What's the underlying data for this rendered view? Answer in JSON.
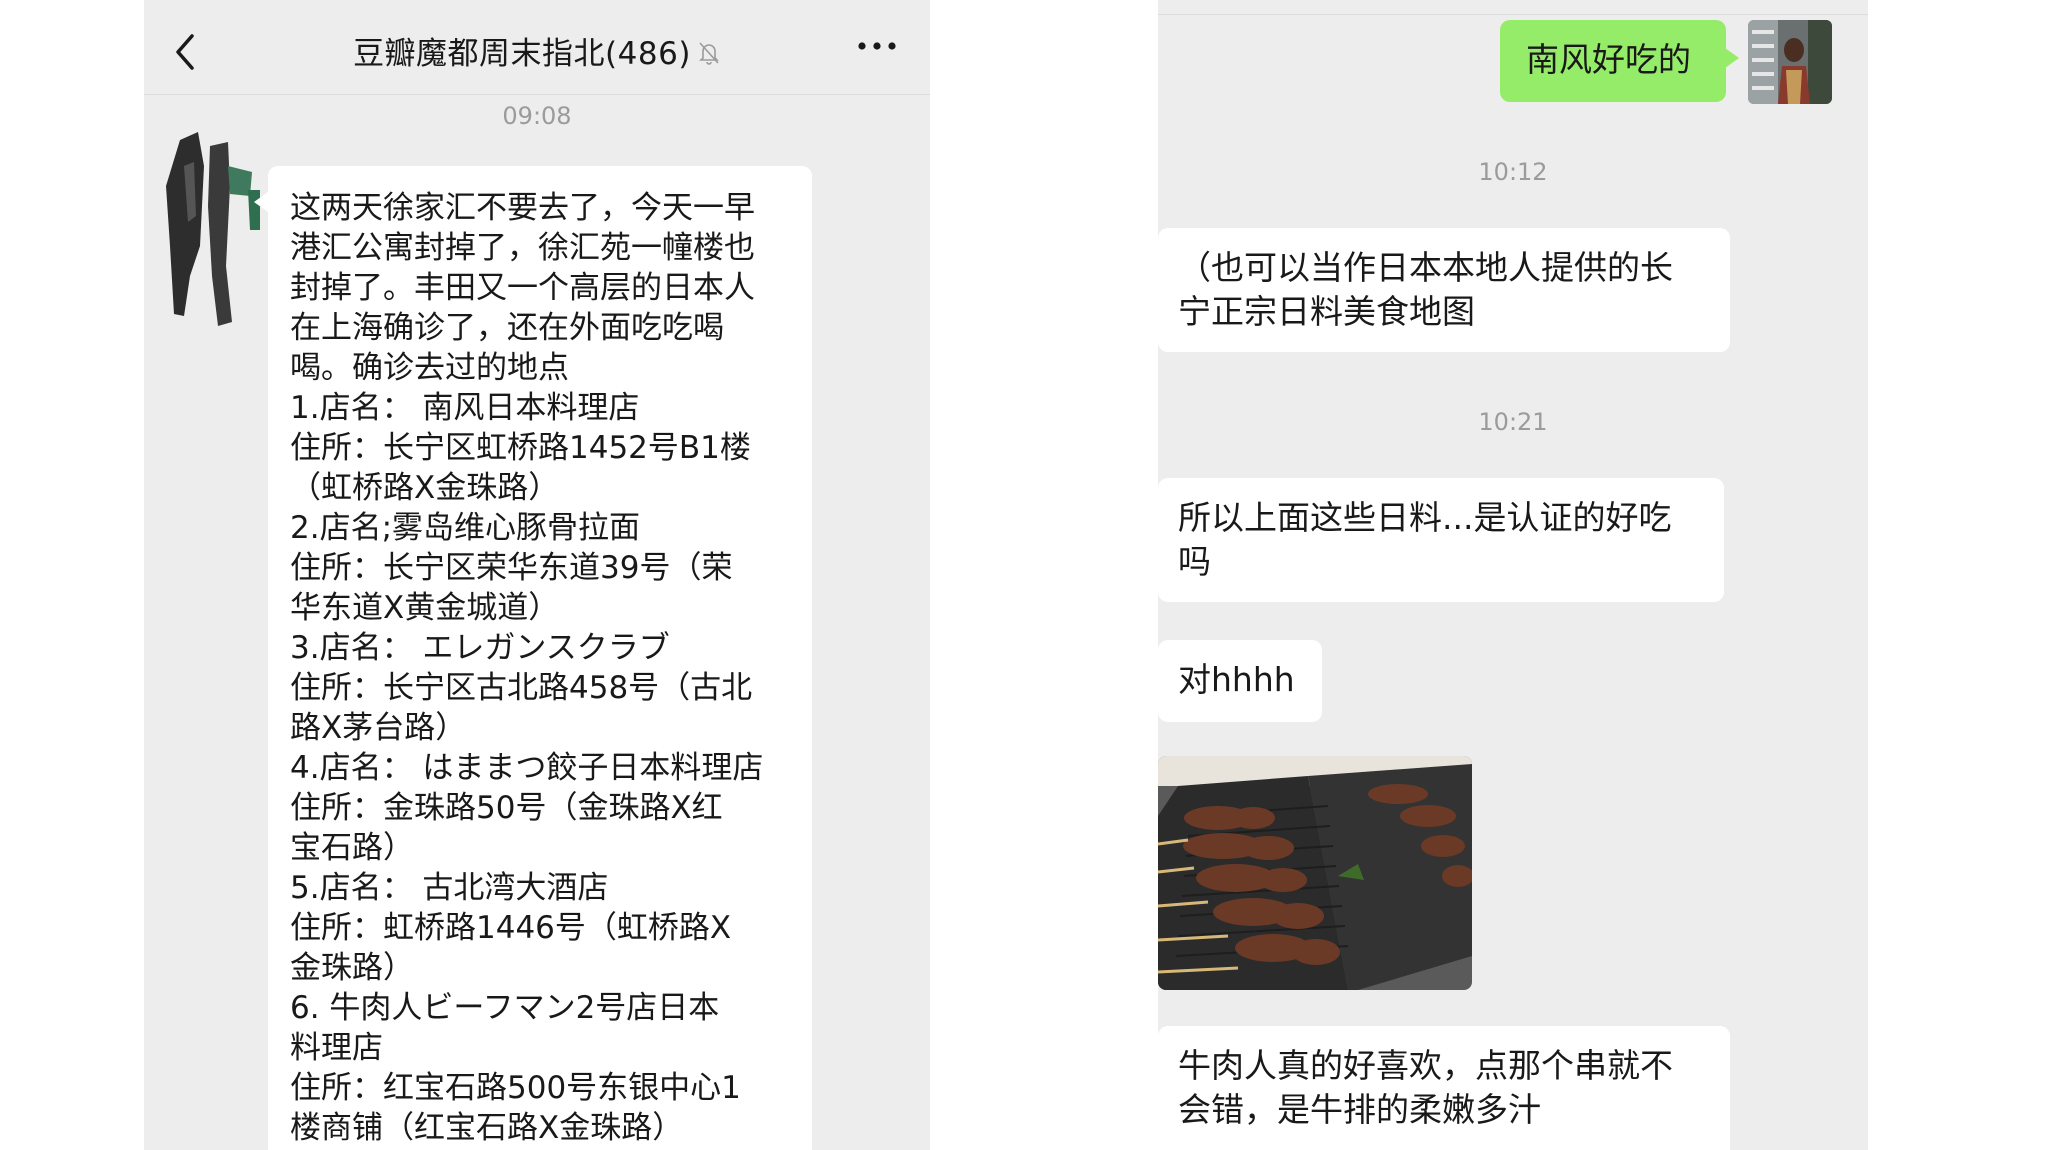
{
  "left": {
    "header": {
      "title": "豆瓣魔都周末指北(486)",
      "back_icon": "chevron-left-icon",
      "mute_icon": "bell-off-icon",
      "more_icon": "more-dots-icon"
    },
    "timestamp": "09:08",
    "message_lines": [
      "这两天徐家汇不要去了，今天一早",
      "港汇公寓封掉了，徐汇苑一幢楼也",
      "封掉了。丰田又一个高层的日本人",
      "在上海确诊了，还在外面吃吃喝",
      "喝。确诊去过的地点",
      "1.店名：  南风日本料理店",
      "住所：长宁区虹桥路1452号B1楼",
      "（虹桥路X金珠路）",
      "2.店名;雾岛维心豚骨拉面",
      "住所：长宁区荣华东道39号（荣",
      "华东道X黄金城道）",
      "3.店名：  エレガンスクラブ",
      "住所：长宁区古北路458号（古北",
      "路X茅台路）",
      "4.店名：  はままつ餃子日本料理店",
      "住所：金珠路50号（金珠路X红",
      "宝石路）",
      "5.店名：  古北湾大酒店",
      "住所：虹桥路1446号（虹桥路X",
      "金珠路）",
      "6.   牛肉人ビーフマン2号店日本",
      "料理店",
      "住所：红宝石路500号东银中心1",
      "楼商铺（红宝石路X金珠路）"
    ]
  },
  "right": {
    "sent_message": "南风好吃的",
    "timestamp_1": "10:12",
    "message_1_lines": [
      "（也可以当作日本本地人提供的长",
      "宁正宗日料美食地图"
    ],
    "timestamp_2": "10:21",
    "message_2_lines": [
      "所以上面这些日料...是认证的好吃",
      "吗"
    ],
    "message_3": "对hhhh",
    "message_4_lines": [
      "牛肉人真的好喜欢，点那个串就不",
      "会错，是牛排的柔嫩多汁"
    ]
  },
  "colors": {
    "chat_background": "#ededed",
    "incoming_bubble": "#ffffff",
    "outgoing_bubble": "#95ec69",
    "timestamp_text": "#9b9b9b",
    "text": "#191919"
  }
}
